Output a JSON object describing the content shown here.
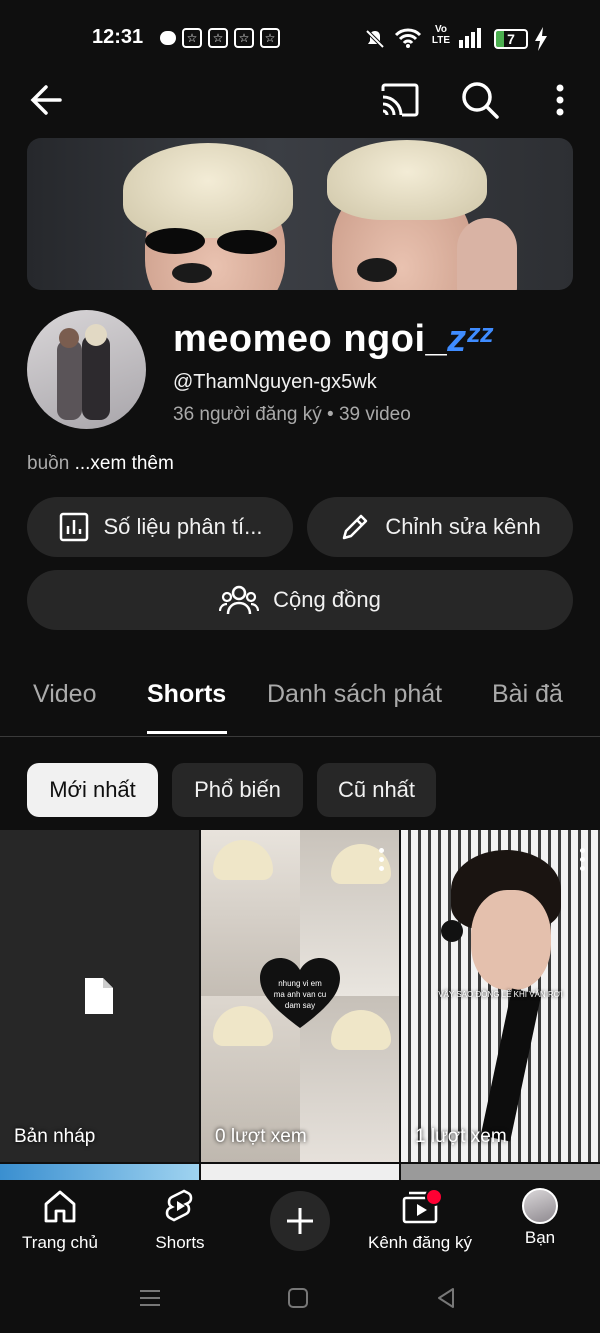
{
  "status_bar": {
    "time": "12:31",
    "network": "Vo LTE",
    "battery": "7"
  },
  "channel": {
    "name": "meomeo ngoi_",
    "name_emoji": "zᶻᶻ",
    "handle": "@ThamNguyen-gx5wk",
    "stats": "36 người đăng ký • 39 video",
    "description": "buồn",
    "more_label": "...xem thêm"
  },
  "actions": {
    "analytics_label": "Số liệu phân tí...",
    "edit_label": "Chỉnh sửa kênh",
    "community_label": "Cộng đồng"
  },
  "tabs": [
    "Video",
    "Shorts",
    "Danh sách phát",
    "Bài đă"
  ],
  "active_tab": "Shorts",
  "filters": [
    "Mới nhất",
    "Phổ biến",
    "Cũ nhất"
  ],
  "grid": [
    {
      "label": "Bản nháp"
    },
    {
      "label": "0 lượt xem",
      "overlay_text": "nhung vi em ma anh van cu dam say"
    },
    {
      "label": "1 lượt xem",
      "overlay_text": "VẬY SAO ĐỒNG LẼ KHI VẪN RƠI"
    }
  ],
  "bottom_nav": [
    {
      "label": "Trang chủ",
      "icon": "home-icon"
    },
    {
      "label": "Shorts",
      "icon": "shorts-icon"
    },
    {
      "label": "",
      "icon": "create-icon"
    },
    {
      "label": "Kênh đăng ký",
      "icon": "subscriptions-icon"
    },
    {
      "label": "Bạn",
      "icon": "avatar"
    }
  ],
  "colors": {
    "background": "#0f0f0f",
    "chip_active": "#f1f1f1",
    "chip_inactive": "#272727",
    "accent_zzz": "#3f8cff",
    "notification": "#ff0033"
  }
}
